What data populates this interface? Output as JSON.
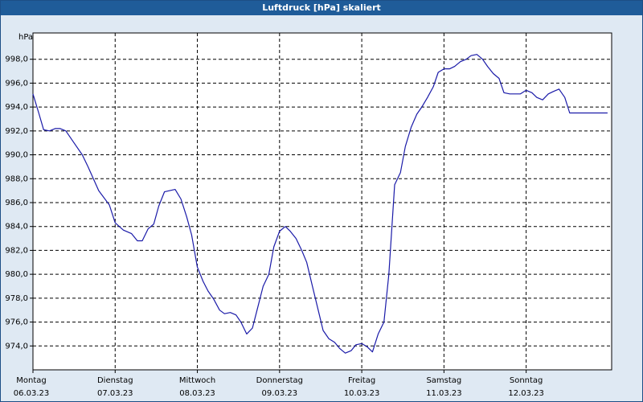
{
  "window": {
    "title": "Luftdruck [hPa] skaliert"
  },
  "chart_data": {
    "type": "line",
    "title": "Luftdruck [hPa] skaliert",
    "ylabel": "hPa",
    "xlabel": "",
    "ylim": [
      972.0,
      1000.2
    ],
    "xlim": [
      0,
      7.04
    ],
    "grid": true,
    "legend": "none",
    "line_color": "#1a1aa8",
    "yticks": [
      "998,0",
      "996,0",
      "994,0",
      "992,0",
      "990,0",
      "988,0",
      "986,0",
      "984,0",
      "982,0",
      "980,0",
      "978,0",
      "976,0",
      "974,0"
    ],
    "ytick_values": [
      998,
      996,
      994,
      992,
      990,
      988,
      986,
      984,
      982,
      980,
      978,
      976,
      974
    ],
    "xticks": [
      {
        "day": "Montag",
        "date": "06.03.23",
        "x": 0
      },
      {
        "day": "Dienstag",
        "date": "07.03.23",
        "x": 1
      },
      {
        "day": "Mittwoch",
        "date": "08.03.23",
        "x": 2
      },
      {
        "day": "Donnerstag",
        "date": "09.03.23",
        "x": 3
      },
      {
        "day": "Freitag",
        "date": "10.03.23",
        "x": 4
      },
      {
        "day": "Samstag",
        "date": "11.03.23",
        "x": 5
      },
      {
        "day": "Sonntag",
        "date": "12.03.23",
        "x": 6
      }
    ],
    "series": [
      {
        "x": [
          0,
          0.07,
          0.13,
          0.2,
          0.27,
          0.33,
          0.4,
          0.5,
          0.6,
          0.67,
          0.8,
          0.93,
          1,
          1.1,
          1.2,
          1.27,
          1.33,
          1.4,
          1.47,
          1.53,
          1.6,
          1.73,
          1.8,
          1.87,
          1.93,
          2,
          2.07,
          2.13,
          2.2,
          2.27,
          2.33,
          2.4,
          2.47,
          2.53,
          2.6,
          2.67,
          2.73,
          2.8,
          2.87,
          2.93,
          3,
          3.07,
          3.13,
          3.2,
          3.27,
          3.33,
          3.4,
          3.47,
          3.53,
          3.6,
          3.67,
          3.73,
          3.8,
          3.87,
          3.93,
          4,
          4.07,
          4.13,
          4.2,
          4.27,
          4.33,
          4.4,
          4.47,
          4.53,
          4.6,
          4.67,
          4.73,
          4.8,
          4.87,
          4.93,
          5,
          5.07,
          5.13,
          5.2,
          5.27,
          5.33,
          5.4,
          5.47,
          5.53,
          5.6,
          5.67,
          5.73,
          5.8,
          5.87,
          5.93,
          6,
          6.07,
          6.13,
          6.2,
          6.27,
          6.33,
          6.4,
          6.47,
          6.53,
          6.6,
          6.67,
          6.73,
          6.8,
          6.87,
          6.93,
          6.99
        ],
        "y": [
          995.1,
          993.5,
          992.1,
          992.0,
          992.2,
          992.2,
          992.0,
          991.0,
          990.0,
          989.0,
          987.0,
          985.8,
          984.3,
          983.7,
          983.4,
          982.8,
          982.8,
          983.8,
          984.2,
          985.7,
          986.9,
          987.1,
          986.3,
          984.8,
          983.3,
          980.6,
          979.4,
          978.6,
          977.9,
          977.0,
          976.7,
          976.8,
          976.6,
          976.0,
          975.0,
          975.5,
          977.1,
          979.0,
          980.0,
          982.3,
          983.6,
          984.0,
          983.6,
          983.0,
          982.0,
          981.0,
          979.0,
          977.0,
          975.3,
          974.6,
          974.3,
          973.8,
          973.4,
          973.6,
          974.1,
          974.2,
          973.9,
          973.5,
          975.0,
          976.0,
          980.0,
          987.5,
          988.5,
          990.7,
          992.3,
          993.4,
          994.0,
          994.8,
          995.7,
          996.9,
          997.2,
          997.2,
          997.4,
          997.8,
          998.0,
          998.3,
          998.4,
          998.0,
          997.4,
          996.8,
          996.4,
          995.2,
          995.1,
          995.1,
          995.1,
          995.4,
          995.2,
          994.8,
          994.6,
          995.1,
          995.3,
          995.5,
          994.8,
          993.5,
          993.5,
          993.5,
          993.5,
          993.5,
          993.5,
          993.5,
          993.5
        ]
      }
    ]
  }
}
